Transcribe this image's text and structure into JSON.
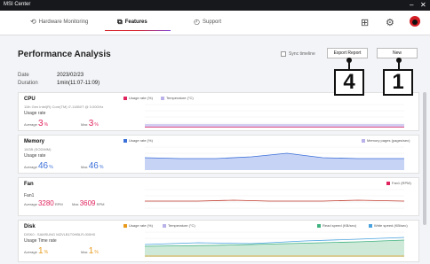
{
  "window": {
    "title": "MSI Center",
    "minimize": "–",
    "close": "✕"
  },
  "nav": {
    "tabs": [
      {
        "label": "Hardware Monitoring",
        "icon": "refresh-icon"
      },
      {
        "label": "Features",
        "icon": "features-icon"
      },
      {
        "label": "Support",
        "icon": "support-icon"
      }
    ],
    "icons": [
      "grid-icon",
      "settings-icon",
      "msi-logo-icon"
    ]
  },
  "page": {
    "title": "Performance Analysis",
    "sync_label": "Sync timeline",
    "export_label": "Export Report",
    "new_label": "New",
    "date_label": "Date",
    "date_value": "2023/02/23",
    "duration_label": "Duration",
    "duration_value": "1min(11:07-11:09)"
  },
  "callouts": {
    "export": "4",
    "new": "1"
  },
  "cards": {
    "cpu": {
      "title": "CPU",
      "subtitle": "11th Gen Intel(R) Core(TM) i7-11850T @ 3.00GHz",
      "metric": "Usage rate",
      "avg_label": "Average",
      "avg_value": "3",
      "avg_unit": "%",
      "max_label": "Max",
      "max_value": "3",
      "max_unit": "%",
      "legend": [
        "Usage rate (%)",
        "Temperature (°C)"
      ]
    },
    "memory": {
      "title": "Memory",
      "subtitle": "16GB (SODIMM)",
      "metric": "Usage rate",
      "avg_label": "Average",
      "avg_value": "46",
      "avg_unit": "%",
      "max_label": "Max",
      "max_value": "46",
      "max_unit": "%",
      "legend": [
        "Usage rate (%)",
        "Memory pages (pages/sec)"
      ]
    },
    "fan": {
      "title": "Fan",
      "subtitle": "Fan1",
      "avg_label": "Average",
      "avg_value": "3280",
      "avg_unit": "RPM",
      "max_label": "Max",
      "max_value": "3609",
      "max_unit": "RPM",
      "legend": [
        "Fan1 (RPM)"
      ]
    },
    "disk": {
      "title": "Disk",
      "subtitle": "DISK0 : SAMSUNG MZVLB1T0HBLR-000H0",
      "metric": "Usage Time rate",
      "avg_label": "Average",
      "avg_value": "1",
      "avg_unit": "%",
      "max_label": "Max",
      "max_value": "1",
      "max_unit": "%",
      "legend": [
        "Usage rate (%)",
        "Temperature (°C)",
        "Read speed (KB/sec)",
        "Write speed (KB/sec)"
      ]
    }
  },
  "colors": {
    "accent_red": "#d41c24",
    "cpu_series": "#e0245e",
    "memory_series": "#3b6fd9",
    "disk_series": "#e89a1c"
  }
}
